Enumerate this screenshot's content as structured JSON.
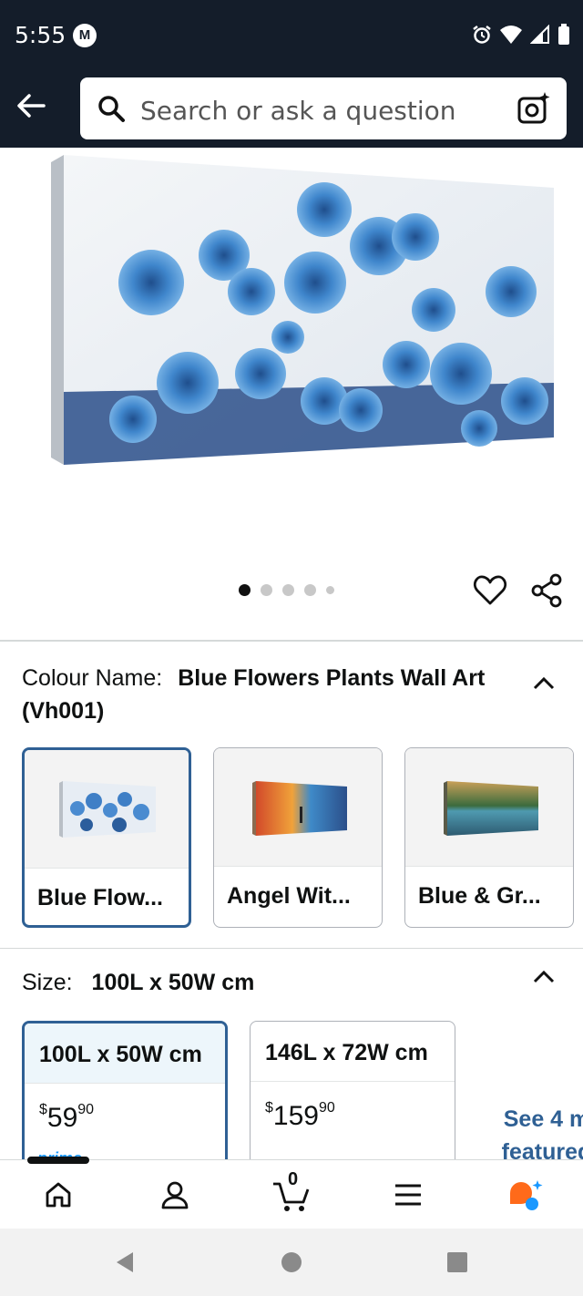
{
  "status_bar": {
    "time": "5:55"
  },
  "search": {
    "placeholder": "Search or ask a question"
  },
  "gallery": {
    "image_count": 5,
    "active_index": 0
  },
  "colour": {
    "label": "Colour Name:",
    "value": "Blue Flowers Plants Wall Art (Vh001)",
    "options": [
      {
        "name": "Blue Flow...",
        "selected": true
      },
      {
        "name": "Angel Wit...",
        "selected": false
      },
      {
        "name": "Blue & Gr...",
        "selected": false
      }
    ]
  },
  "size": {
    "label": "Size:",
    "value": "100L x 50W cm",
    "options": [
      {
        "name": "100L x 50W cm",
        "price_currency": "$",
        "price_whole": "59",
        "price_fraction": "90",
        "badge": "prime",
        "selected": true
      },
      {
        "name": "146L x 72W cm",
        "price_currency": "$",
        "price_whole": "159",
        "price_fraction": "90",
        "selected": false
      }
    ],
    "see_more_line1": "See 4 m",
    "see_more_line2": "featured"
  },
  "cart": {
    "count": "0"
  },
  "colors": {
    "header_bg": "#141d2a",
    "selected_border": "#2f6094",
    "link": "#2f6094",
    "prime": "#1a98ff"
  }
}
